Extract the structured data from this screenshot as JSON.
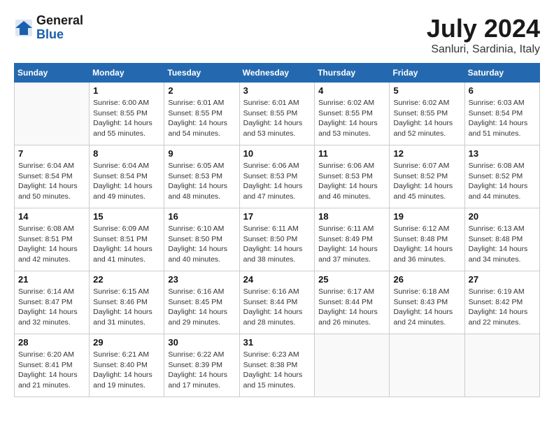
{
  "header": {
    "logo_general": "General",
    "logo_blue": "Blue",
    "title": "July 2024",
    "location": "Sanluri, Sardinia, Italy"
  },
  "weekdays": [
    "Sunday",
    "Monday",
    "Tuesday",
    "Wednesday",
    "Thursday",
    "Friday",
    "Saturday"
  ],
  "weeks": [
    [
      {
        "day": "",
        "empty": true
      },
      {
        "day": "1",
        "sunrise": "Sunrise: 6:00 AM",
        "sunset": "Sunset: 8:55 PM",
        "daylight": "Daylight: 14 hours and 55 minutes."
      },
      {
        "day": "2",
        "sunrise": "Sunrise: 6:01 AM",
        "sunset": "Sunset: 8:55 PM",
        "daylight": "Daylight: 14 hours and 54 minutes."
      },
      {
        "day": "3",
        "sunrise": "Sunrise: 6:01 AM",
        "sunset": "Sunset: 8:55 PM",
        "daylight": "Daylight: 14 hours and 53 minutes."
      },
      {
        "day": "4",
        "sunrise": "Sunrise: 6:02 AM",
        "sunset": "Sunset: 8:55 PM",
        "daylight": "Daylight: 14 hours and 53 minutes."
      },
      {
        "day": "5",
        "sunrise": "Sunrise: 6:02 AM",
        "sunset": "Sunset: 8:55 PM",
        "daylight": "Daylight: 14 hours and 52 minutes."
      },
      {
        "day": "6",
        "sunrise": "Sunrise: 6:03 AM",
        "sunset": "Sunset: 8:54 PM",
        "daylight": "Daylight: 14 hours and 51 minutes."
      }
    ],
    [
      {
        "day": "7",
        "sunrise": "Sunrise: 6:04 AM",
        "sunset": "Sunset: 8:54 PM",
        "daylight": "Daylight: 14 hours and 50 minutes."
      },
      {
        "day": "8",
        "sunrise": "Sunrise: 6:04 AM",
        "sunset": "Sunset: 8:54 PM",
        "daylight": "Daylight: 14 hours and 49 minutes."
      },
      {
        "day": "9",
        "sunrise": "Sunrise: 6:05 AM",
        "sunset": "Sunset: 8:53 PM",
        "daylight": "Daylight: 14 hours and 48 minutes."
      },
      {
        "day": "10",
        "sunrise": "Sunrise: 6:06 AM",
        "sunset": "Sunset: 8:53 PM",
        "daylight": "Daylight: 14 hours and 47 minutes."
      },
      {
        "day": "11",
        "sunrise": "Sunrise: 6:06 AM",
        "sunset": "Sunset: 8:53 PM",
        "daylight": "Daylight: 14 hours and 46 minutes."
      },
      {
        "day": "12",
        "sunrise": "Sunrise: 6:07 AM",
        "sunset": "Sunset: 8:52 PM",
        "daylight": "Daylight: 14 hours and 45 minutes."
      },
      {
        "day": "13",
        "sunrise": "Sunrise: 6:08 AM",
        "sunset": "Sunset: 8:52 PM",
        "daylight": "Daylight: 14 hours and 44 minutes."
      }
    ],
    [
      {
        "day": "14",
        "sunrise": "Sunrise: 6:08 AM",
        "sunset": "Sunset: 8:51 PM",
        "daylight": "Daylight: 14 hours and 42 minutes."
      },
      {
        "day": "15",
        "sunrise": "Sunrise: 6:09 AM",
        "sunset": "Sunset: 8:51 PM",
        "daylight": "Daylight: 14 hours and 41 minutes."
      },
      {
        "day": "16",
        "sunrise": "Sunrise: 6:10 AM",
        "sunset": "Sunset: 8:50 PM",
        "daylight": "Daylight: 14 hours and 40 minutes."
      },
      {
        "day": "17",
        "sunrise": "Sunrise: 6:11 AM",
        "sunset": "Sunset: 8:50 PM",
        "daylight": "Daylight: 14 hours and 38 minutes."
      },
      {
        "day": "18",
        "sunrise": "Sunrise: 6:11 AM",
        "sunset": "Sunset: 8:49 PM",
        "daylight": "Daylight: 14 hours and 37 minutes."
      },
      {
        "day": "19",
        "sunrise": "Sunrise: 6:12 AM",
        "sunset": "Sunset: 8:48 PM",
        "daylight": "Daylight: 14 hours and 36 minutes."
      },
      {
        "day": "20",
        "sunrise": "Sunrise: 6:13 AM",
        "sunset": "Sunset: 8:48 PM",
        "daylight": "Daylight: 14 hours and 34 minutes."
      }
    ],
    [
      {
        "day": "21",
        "sunrise": "Sunrise: 6:14 AM",
        "sunset": "Sunset: 8:47 PM",
        "daylight": "Daylight: 14 hours and 32 minutes."
      },
      {
        "day": "22",
        "sunrise": "Sunrise: 6:15 AM",
        "sunset": "Sunset: 8:46 PM",
        "daylight": "Daylight: 14 hours and 31 minutes."
      },
      {
        "day": "23",
        "sunrise": "Sunrise: 6:16 AM",
        "sunset": "Sunset: 8:45 PM",
        "daylight": "Daylight: 14 hours and 29 minutes."
      },
      {
        "day": "24",
        "sunrise": "Sunrise: 6:16 AM",
        "sunset": "Sunset: 8:44 PM",
        "daylight": "Daylight: 14 hours and 28 minutes."
      },
      {
        "day": "25",
        "sunrise": "Sunrise: 6:17 AM",
        "sunset": "Sunset: 8:44 PM",
        "daylight": "Daylight: 14 hours and 26 minutes."
      },
      {
        "day": "26",
        "sunrise": "Sunrise: 6:18 AM",
        "sunset": "Sunset: 8:43 PM",
        "daylight": "Daylight: 14 hours and 24 minutes."
      },
      {
        "day": "27",
        "sunrise": "Sunrise: 6:19 AM",
        "sunset": "Sunset: 8:42 PM",
        "daylight": "Daylight: 14 hours and 22 minutes."
      }
    ],
    [
      {
        "day": "28",
        "sunrise": "Sunrise: 6:20 AM",
        "sunset": "Sunset: 8:41 PM",
        "daylight": "Daylight: 14 hours and 21 minutes."
      },
      {
        "day": "29",
        "sunrise": "Sunrise: 6:21 AM",
        "sunset": "Sunset: 8:40 PM",
        "daylight": "Daylight: 14 hours and 19 minutes."
      },
      {
        "day": "30",
        "sunrise": "Sunrise: 6:22 AM",
        "sunset": "Sunset: 8:39 PM",
        "daylight": "Daylight: 14 hours and 17 minutes."
      },
      {
        "day": "31",
        "sunrise": "Sunrise: 6:23 AM",
        "sunset": "Sunset: 8:38 PM",
        "daylight": "Daylight: 14 hours and 15 minutes."
      },
      {
        "day": "",
        "empty": true
      },
      {
        "day": "",
        "empty": true
      },
      {
        "day": "",
        "empty": true
      }
    ]
  ]
}
